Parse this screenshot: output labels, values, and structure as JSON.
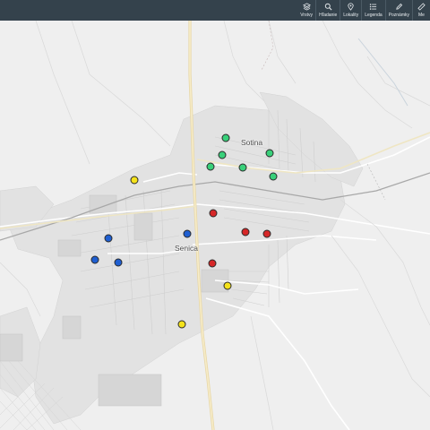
{
  "toolbar": {
    "items": [
      {
        "label": "Vrstvy",
        "icon": "layers-icon"
      },
      {
        "label": "Hľadanie",
        "icon": "search-icon"
      },
      {
        "label": "Lokality",
        "icon": "location-pin-icon"
      },
      {
        "label": "Legenda",
        "icon": "list-icon"
      },
      {
        "label": "Poznámky",
        "icon": "pencil-icon"
      },
      {
        "label": "Me",
        "icon": "measure-icon"
      }
    ]
  },
  "map": {
    "places": {
      "sotina": "Sotina",
      "senica": "Senica"
    },
    "marker_colors": {
      "green": "#39d07a",
      "red": "#d62728",
      "blue": "#1f5fd1",
      "yellow": "#f4e21b"
    },
    "markers": [
      {
        "category": "green"
      },
      {
        "category": "green"
      },
      {
        "category": "green"
      },
      {
        "category": "green"
      },
      {
        "category": "green"
      },
      {
        "category": "green"
      },
      {
        "category": "red"
      },
      {
        "category": "red"
      },
      {
        "category": "red"
      },
      {
        "category": "red"
      },
      {
        "category": "blue"
      },
      {
        "category": "blue"
      },
      {
        "category": "blue"
      },
      {
        "category": "blue"
      },
      {
        "category": "yellow"
      },
      {
        "category": "yellow"
      },
      {
        "category": "yellow"
      }
    ]
  }
}
